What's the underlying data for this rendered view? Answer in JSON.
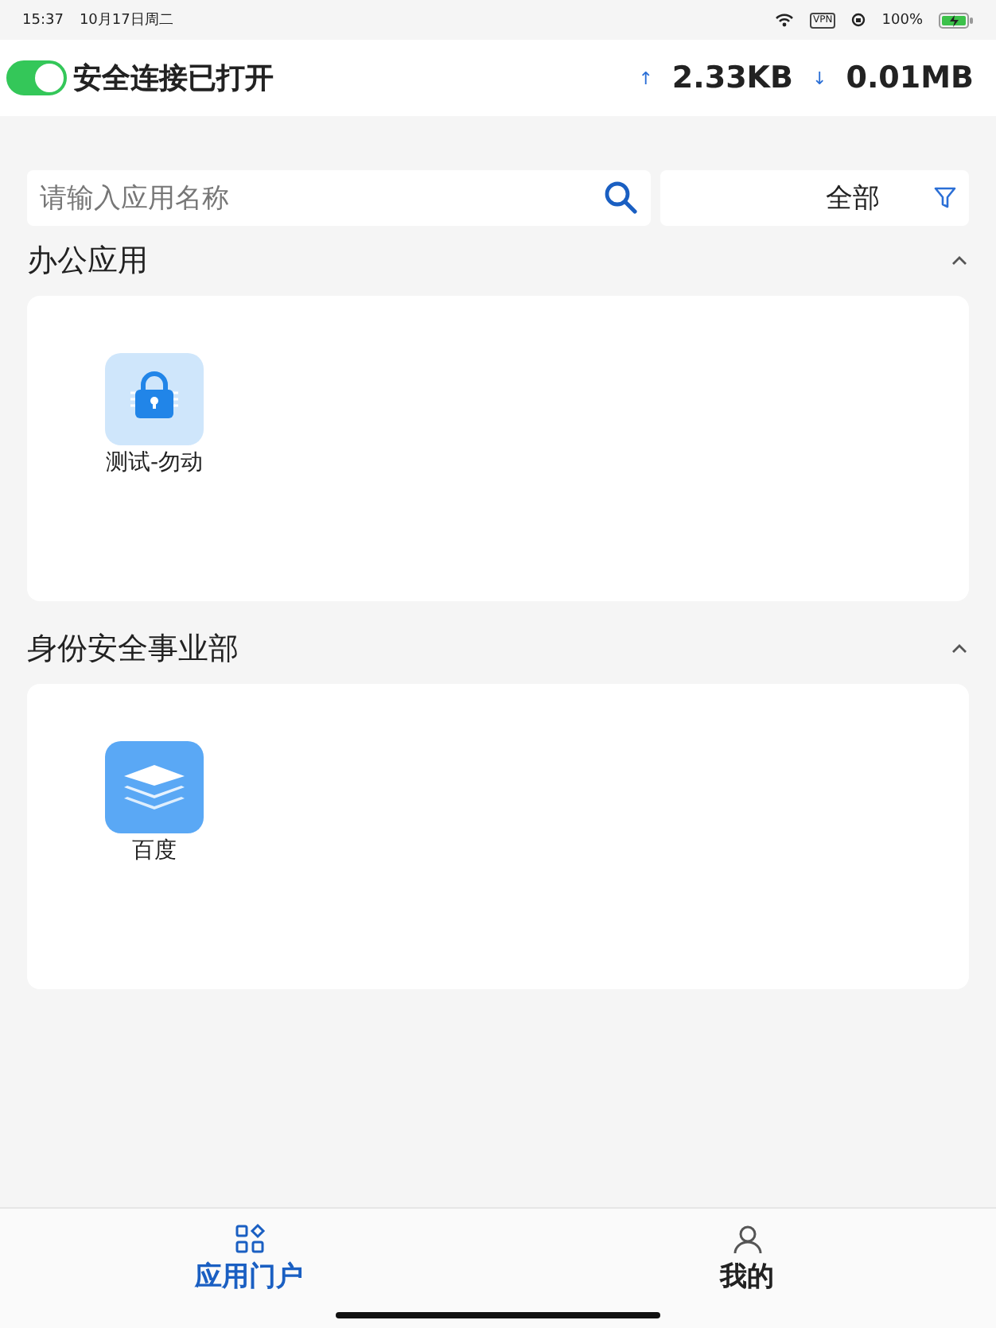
{
  "status_bar": {
    "time": "15:37",
    "date": "10月17日周二",
    "vpn": "VPN",
    "battery": "100%"
  },
  "header": {
    "toggle_on": true,
    "title": "安全连接已打开",
    "upload_arrow": "↑",
    "upload": "2.33KB",
    "download_arrow": "↓",
    "download": "0.01MB"
  },
  "search": {
    "placeholder": "请输入应用名称"
  },
  "filter": {
    "value": "全部"
  },
  "sections": [
    {
      "title": "办公应用",
      "expanded": true,
      "apps": [
        {
          "name": "测试-勿动",
          "kind": "lock"
        }
      ]
    },
    {
      "title": "身份安全事业部",
      "expanded": true,
      "apps": [
        {
          "name": "百度",
          "kind": "layers"
        }
      ]
    }
  ],
  "tabs": [
    {
      "label": "应用门户",
      "kind": "apps",
      "selected": true
    },
    {
      "label": "我的",
      "kind": "person",
      "selected": false
    }
  ]
}
